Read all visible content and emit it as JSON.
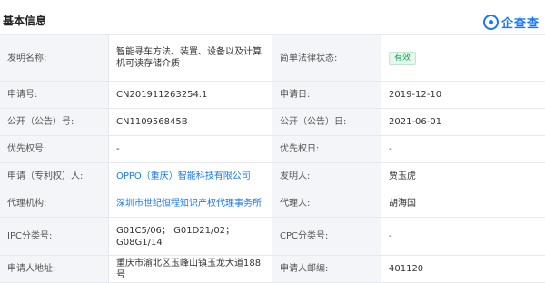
{
  "header": {
    "title": "基本信息",
    "logo_text": "企查查"
  },
  "rows": [
    {
      "l1": "发明名称:",
      "v1": "智能寻车方法、装置、设备以及计算机可读存储介质",
      "l2": "简单法律状态:",
      "v2": "有效"
    },
    {
      "l1": "申请号:",
      "v1": "CN201911263254.1",
      "l2": "申请日:",
      "v2": "2019-12-10"
    },
    {
      "l1": "公开（公告）号:",
      "v1": "CN110956845B",
      "l2": "公开（公告）日:",
      "v2": "2021-06-01"
    },
    {
      "l1": "优先权号:",
      "v1": "-",
      "l2": "优先权日:",
      "v2": "-"
    },
    {
      "l1": "申请（专利权）人:",
      "v1": "OPPO（重庆）智能科技有限公司",
      "l2": "发明人:",
      "v2": "贾玉虎"
    },
    {
      "l1": "代理机构:",
      "v1": "深圳市世纪恒程知识产权代理事务所",
      "l2": "代理人:",
      "v2": "胡海国"
    },
    {
      "l1": "IPC分类号:",
      "v1": "G01C5/06； G01D21/02； G08G1/14",
      "l2": "CPC分类号:",
      "v2": "-"
    },
    {
      "l1": "申请人地址:",
      "v1": "重庆市渝北区玉峰山镇玉龙大道188号",
      "l2": "申请人邮编:",
      "v2": "401120"
    }
  ],
  "colors": {
    "link": "#1677ff",
    "status_green": "#1aa35a",
    "label_bg": "#f3f5f8",
    "border": "#e6e9ef"
  }
}
